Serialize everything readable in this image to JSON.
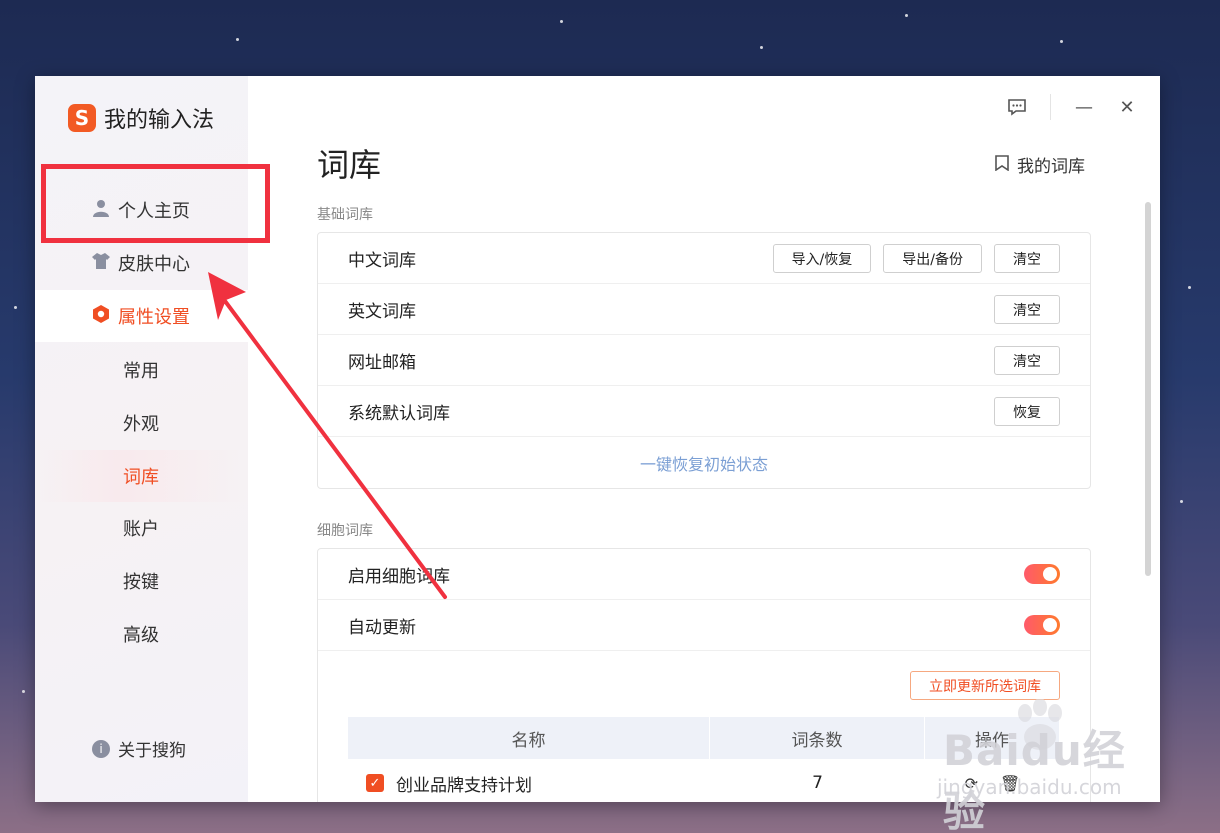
{
  "app": {
    "logo_glyph": "S",
    "name": "我的输入法"
  },
  "titlebar": {
    "feedback_icon": "message-icon",
    "minimize_glyph": "—",
    "close_glyph": "✕"
  },
  "sidebar": {
    "items": [
      {
        "label": "个人主页",
        "icon": "user-icon"
      },
      {
        "label": "皮肤中心",
        "icon": "shirt-icon"
      },
      {
        "label": "属性设置",
        "icon": "hexagon-icon",
        "active": true
      }
    ],
    "sub_items": [
      {
        "label": "常用"
      },
      {
        "label": "外观"
      },
      {
        "label": "词库",
        "active": true
      },
      {
        "label": "账户"
      },
      {
        "label": "按键"
      },
      {
        "label": "高级"
      }
    ],
    "about": "关于搜狗"
  },
  "page": {
    "title": "词库",
    "my_library": "我的词库"
  },
  "basic_section": {
    "label": "基础词库",
    "rows": [
      {
        "name": "中文词库",
        "buttons": [
          "导入/恢复",
          "导出/备份",
          "清空"
        ]
      },
      {
        "name": "英文词库",
        "buttons": [
          "清空"
        ]
      },
      {
        "name": "网址邮箱",
        "buttons": [
          "清空"
        ]
      },
      {
        "name": "系统默认词库",
        "buttons": [
          "恢复"
        ]
      }
    ],
    "restore_all": "一键恢复初始状态"
  },
  "cell_section": {
    "label": "细胞词库",
    "enable_label": "启用细胞词库",
    "enable_on": true,
    "auto_update_label": "自动更新",
    "auto_update_on": true,
    "update_button": "立即更新所选词库",
    "table": {
      "headers": [
        "名称",
        "词条数",
        "操作"
      ],
      "rows": [
        {
          "name": "创业品牌支持计划",
          "count": "7",
          "checked": true
        }
      ]
    }
  },
  "watermark": {
    "brand": "Baidu经验",
    "url": "jingyan.baidu.com"
  },
  "colors": {
    "accent": "#f04e23",
    "highlight_box": "#f0313f",
    "link": "#7b9fd4"
  }
}
